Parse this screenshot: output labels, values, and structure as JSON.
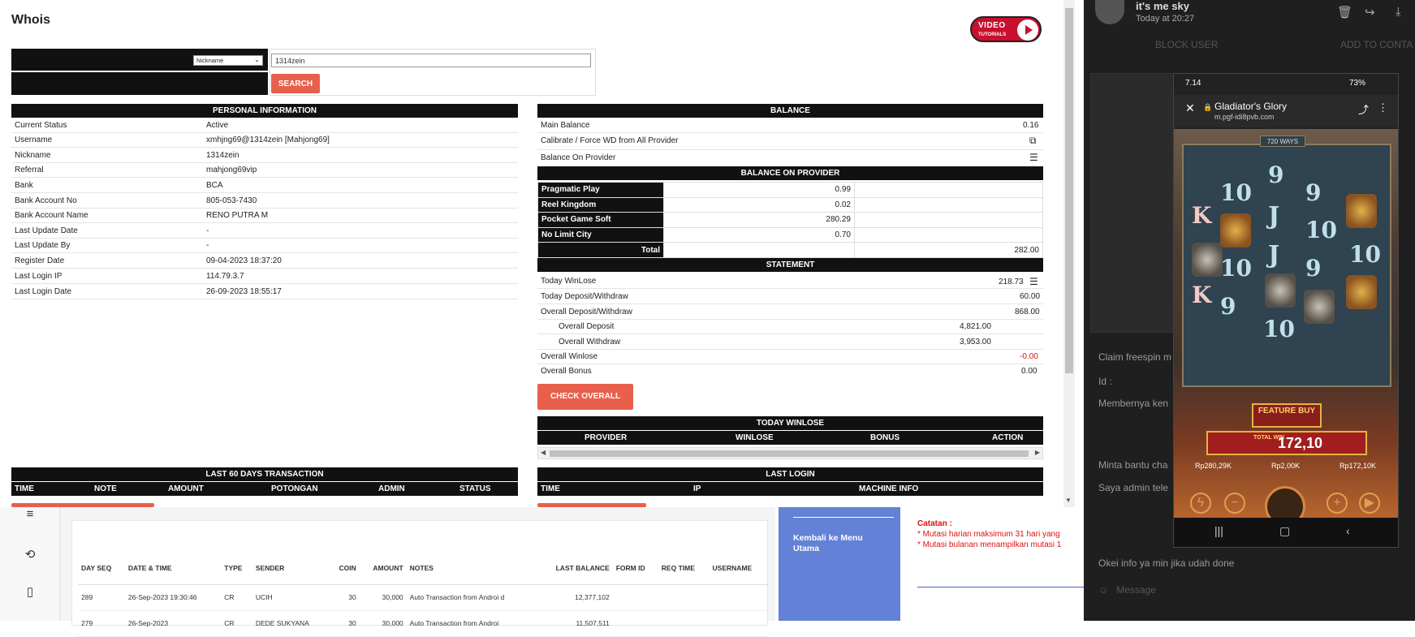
{
  "whois": {
    "title": "Whois",
    "video_badge": {
      "line1": "VIDEO",
      "line2": "TUTORIALS"
    },
    "search": {
      "type": "Nickname",
      "value": "1314zein",
      "button": "SEARCH"
    },
    "personal": {
      "header": "PERSONAL INFORMATION",
      "rows": [
        {
          "label": "Current Status",
          "value": "Active"
        },
        {
          "label": "Username",
          "value": "xmhjng69@1314zein  [Mahjong69]"
        },
        {
          "label": "Nickname",
          "value": "1314zein"
        },
        {
          "label": "Referral",
          "value": "mahjong69vip"
        },
        {
          "label": "Bank",
          "value": "BCA"
        },
        {
          "label": "Bank Account No",
          "value": "805-053-7430"
        },
        {
          "label": "Bank Account Name",
          "value": "RENO PUTRA M"
        },
        {
          "label": "Last Update Date",
          "value": "-"
        },
        {
          "label": "Last Update By",
          "value": "-"
        },
        {
          "label": "Register Date",
          "value": "09-04-2023 18:37:20"
        },
        {
          "label": "Last Login IP",
          "value": "114.79.3.7"
        },
        {
          "label": "Last Login Date",
          "value": "26-09-2023 18:55:17"
        }
      ]
    },
    "balance": {
      "header": "BALANCE",
      "main_label": "Main Balance",
      "main_value": "0.16",
      "calibrate_label": "Calibrate / Force WD from All Provider",
      "on_provider_label": "Balance On Provider",
      "on_provider_header": "BALANCE ON PROVIDER",
      "providers": [
        {
          "name": "Pragmatic Play",
          "value": "0.99"
        },
        {
          "name": "Reel Kingdom",
          "value": "0.02"
        },
        {
          "name": "Pocket Game Soft",
          "value": "280.29"
        },
        {
          "name": "No Limit City",
          "value": "0.70"
        }
      ],
      "total_label": "Total",
      "total_value": "282.00"
    },
    "statement": {
      "header": "STATEMENT",
      "today_winlose_label": "Today WinLose",
      "today_winlose_value": "218.73",
      "today_dw_label": "Today Deposit/Withdraw",
      "today_dw_value": "60.00",
      "overall_dw_label": "Overall Deposit/Withdraw",
      "overall_dw_value": "868.00",
      "overall_deposit_label": "Overall Deposit",
      "overall_deposit_value": "4,821.00",
      "overall_withdraw_label": "Overall Withdraw",
      "overall_withdraw_value": "3,953.00",
      "overall_winlose_label": "Overall Winlose",
      "overall_winlose_value": "-0.00",
      "overall_bonus_label": "Overall Bonus",
      "overall_bonus_value": "0.00",
      "check_button": "CHECK OVERALL"
    },
    "today_winlose": {
      "header": "TODAY WINLOSE",
      "columns": [
        "PROVIDER",
        "WINLOSE",
        "BONUS",
        "ACTION"
      ]
    },
    "last60": {
      "header": "LAST 60 DAYS TRANSACTION",
      "columns": [
        "TIME",
        "NOTE",
        "AMOUNT",
        "POTONGAN",
        "ADMIN",
        "STATUS"
      ]
    },
    "last_login": {
      "header": "LAST LOGIN",
      "columns": [
        "TIME",
        "IP",
        "MACHINE INFO"
      ]
    }
  },
  "bg_table": {
    "headers": [
      "DAY SEQ",
      "DATE & TIME",
      "TYPE",
      "SENDER",
      "COIN",
      "AMOUNT",
      "NOTES",
      "LAST BALANCE",
      "FORM ID",
      "REQ TIME",
      "USERNAME"
    ],
    "rows": [
      [
        "289",
        "26-Sep-2023 19:30:46",
        "CR",
        "UCIH",
        "30",
        "30,000",
        "Auto Transaction from Androi d",
        "12,377,102",
        "",
        "",
        ""
      ],
      [
        "279",
        "26-Sep-2023",
        "CR",
        "DEDE SUKYANA",
        "30",
        "30,000",
        "Auto Transaction from Androi",
        "11,507,511",
        "",
        "",
        ""
      ]
    ]
  },
  "bank": {
    "back_label": "Kembali ke Menu Utama",
    "notes_title": "Catatan :",
    "note1": "* Mutasi harian maksimum 31 hari yang",
    "note2": "* Mutasi bulanan menampilkan mutasi 1"
  },
  "chat": {
    "name": "it's me sky",
    "time": "Today at 20:27",
    "block": "BLOCK USER",
    "add": "ADD TO CONTA",
    "messages": [
      "Claim freespin m",
      "Id :",
      "Membernya ken",
      "Minta bantu cha",
      "Saya admin tele",
      "Okei info ya min jika udah done"
    ],
    "input_placeholder": "Message"
  },
  "phone": {
    "status_time": "7.14",
    "status_battery": "73%",
    "game_title": "Gladiator's Glory",
    "game_domain": "m.pgf-idi8pvb.com",
    "ways": "720 WAYS",
    "feature": "FEATURE BUY",
    "total_win_label": "TOTAL WIN",
    "total_win": "172,10",
    "stat_balance": "Rp280,29K",
    "stat_bet": "Rp2,00K",
    "stat_win": "Rp172,10K"
  }
}
